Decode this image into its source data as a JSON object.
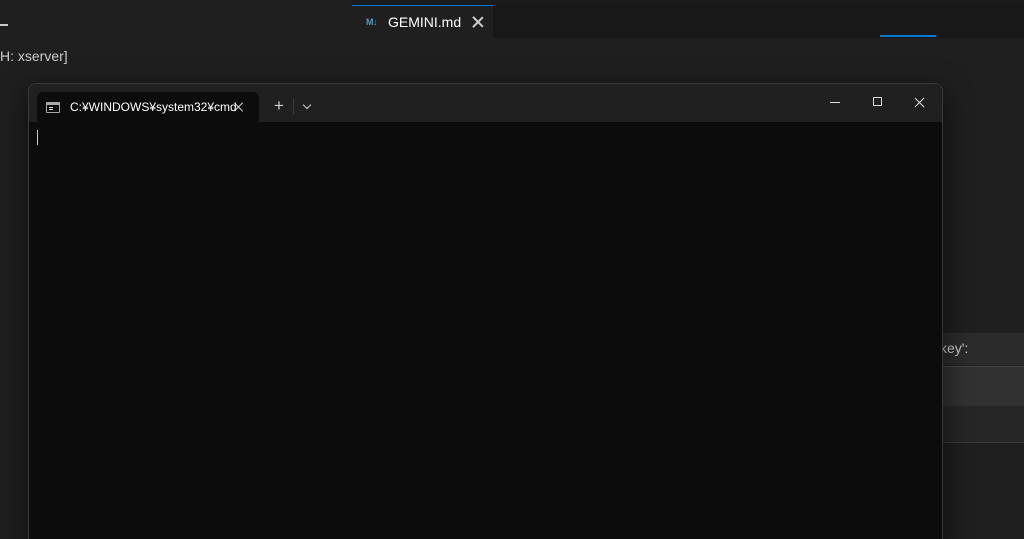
{
  "background": {
    "left_panel_text": "H: xserver]",
    "editor_tab": {
      "label": "GEMINI.md",
      "icon": "markdown-icon"
    },
    "panel_text": "key':"
  },
  "terminal": {
    "tab": {
      "title": "C:¥WINDOWS¥system32¥cmd",
      "icon": "cmd-icon"
    },
    "new_tab_label": "+",
    "controls": [
      "minimize-icon",
      "maximize-icon",
      "close-icon"
    ]
  },
  "colors": {
    "accent": "#0078d4",
    "terminal_bg": "#0c0c0c",
    "titlebar_bg": "#202020",
    "editor_bg": "#1f1f1f"
  }
}
